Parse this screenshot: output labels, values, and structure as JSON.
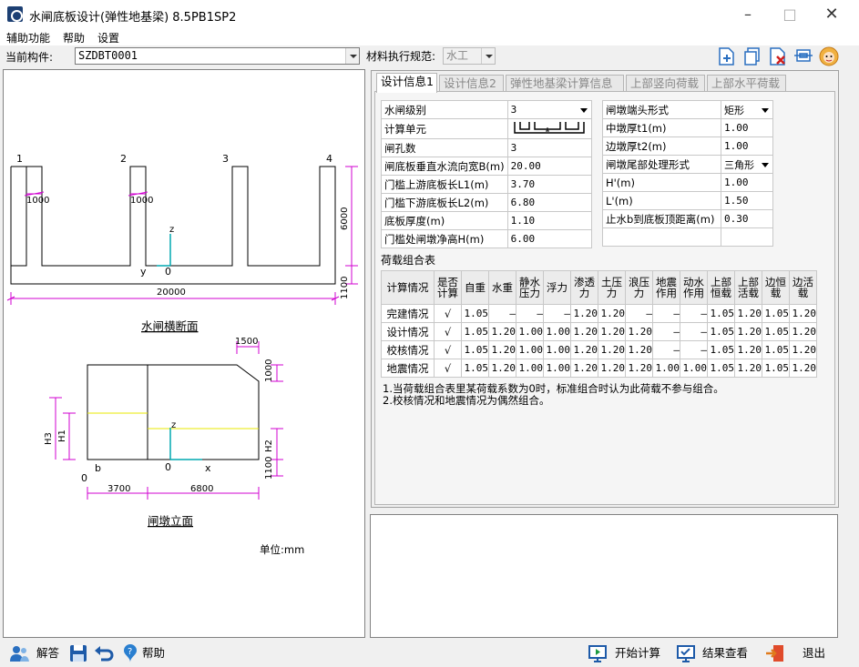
{
  "window": {
    "title": "水闸底板设计(弹性地基梁) 8.5PB1SP2"
  },
  "menu": [
    "辅助功能",
    "帮助",
    "设置"
  ],
  "toolbar": {
    "component_label": "当前构件:",
    "component_value": "SZDBT0001",
    "material_label": "材料执行规范:",
    "material_value": "水工"
  },
  "tabs": [
    "设计信息1",
    "设计信息2",
    "弹性地基梁计算信息",
    "上部竖向荷载",
    "上部水平荷载"
  ],
  "params_left": [
    {
      "label": "水闸级别",
      "value": "3",
      "type": "dropdown"
    },
    {
      "label": "计算单元",
      "value": "",
      "type": "image"
    },
    {
      "label": "闸孔数",
      "value": "3"
    },
    {
      "label": "闸底板垂直水流向宽B(m)",
      "value": "20.00"
    },
    {
      "label": "门槛上游底板长L1(m)",
      "value": "3.70"
    },
    {
      "label": "门槛下游底板长L2(m)",
      "value": "6.80"
    },
    {
      "label": "底板厚度(m)",
      "value": "1.10"
    },
    {
      "label": "门槛处闸墩净高H(m)",
      "value": "6.00"
    }
  ],
  "params_right": [
    {
      "label": "闸墩端头形式",
      "value": "矩形",
      "type": "dropdown"
    },
    {
      "label": "中墩厚t1(m)",
      "value": "1.00"
    },
    {
      "label": "边墩厚t2(m)",
      "value": "1.00"
    },
    {
      "label": "闸墩尾部处理形式",
      "value": "三角形",
      "type": "dropdown"
    },
    {
      "label": "H'(m)",
      "value": "1.00"
    },
    {
      "label": "L'(m)",
      "value": "1.50"
    },
    {
      "label": "止水b到底板顶距离(m)",
      "value": "0.30"
    },
    {
      "label": "",
      "value": ""
    }
  ],
  "load_table": {
    "title": "荷载组合表",
    "headers": [
      "计算情况",
      "是否计算",
      "自重",
      "水重",
      "静水压力",
      "浮力",
      "渗透力",
      "土压力",
      "浪压力",
      "地震作用",
      "动水作用",
      "上部恒载",
      "上部活载",
      "边恒载",
      "边活载"
    ],
    "rows": [
      [
        "完建情况",
        "√",
        "1.05",
        "—",
        "—",
        "—",
        "1.20",
        "1.20",
        "—",
        "—",
        "—",
        "1.05",
        "1.20",
        "1.05",
        "1.20"
      ],
      [
        "设计情况",
        "√",
        "1.05",
        "1.20",
        "1.00",
        "1.00",
        "1.20",
        "1.20",
        "1.20",
        "—",
        "—",
        "1.05",
        "1.20",
        "1.05",
        "1.20"
      ],
      [
        "校核情况",
        "√",
        "1.05",
        "1.20",
        "1.00",
        "1.00",
        "1.20",
        "1.20",
        "1.20",
        "—",
        "—",
        "1.05",
        "1.20",
        "1.05",
        "1.20"
      ],
      [
        "地震情况",
        "√",
        "1.05",
        "1.20",
        "1.00",
        "1.00",
        "1.20",
        "1.20",
        "1.20",
        "1.00",
        "1.00",
        "1.05",
        "1.20",
        "1.05",
        "1.20"
      ]
    ]
  },
  "notes": [
    "1.当荷载组合表里某荷载系数为0时，标准组合时认为此荷载不参与组合。",
    "2.校核情况和地震情况为偶然组合。"
  ],
  "drawing": {
    "section_title": "水闸横断面",
    "elevation_title": "闸墩立面",
    "unit": "单位:mm",
    "pier_numbers": [
      "1",
      "2",
      "3",
      "4"
    ],
    "dim_pier": "1000",
    "dim_height": "6000",
    "dim_bottom": "1100",
    "dim_width": "20000",
    "axis_z": "z",
    "axis_y": "y",
    "axis_x": "x",
    "origin": "0",
    "dim_1500": "1500",
    "dim_1000": "1000",
    "dim_h3": "H3",
    "dim_h1": "H1",
    "dim_h2": "H2",
    "dim_b": "b",
    "dim_3700": "3700",
    "dim_6800": "6800",
    "dim_100": "1100"
  },
  "statusbar": {
    "solve": "解答",
    "help": "帮助",
    "start": "开始计算",
    "result": "结果查看",
    "exit": "退出"
  }
}
